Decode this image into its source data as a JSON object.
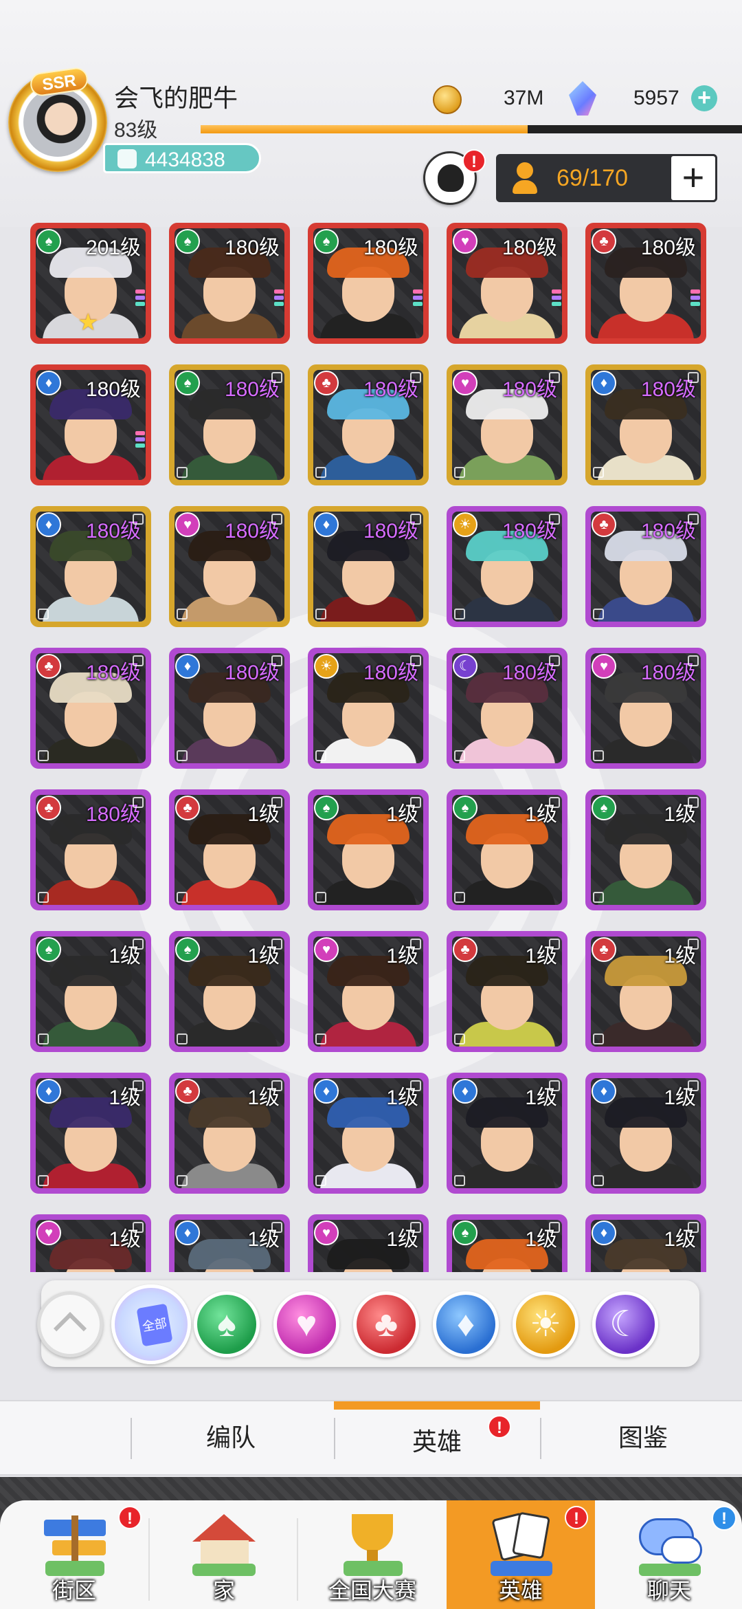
{
  "player": {
    "name": "会飞的肥牛",
    "level": "83级",
    "power": "4434838",
    "rank_badge": "SSR",
    "exp_progress": 0.6
  },
  "currency": {
    "coins": "37M",
    "gems": "5957",
    "coin_icon": "gold-coin-icon",
    "gem_icon": "crystal-gem-icon"
  },
  "hero_capacity": "69/170",
  "notifications": {
    "badge": "!"
  },
  "rarity_colors": {
    "red": "#d63b33",
    "gold": "#d6a62c",
    "purple": "#b04ad0"
  },
  "faction_colors": {
    "spade": "#23a04e",
    "heart": "#d23fba",
    "club": "#d33a3e",
    "diamond": "#2f77d8",
    "sun": "#e6a218",
    "moon": "#7741cf"
  },
  "heroes": [
    {
      "level": "201级",
      "rarity": "red",
      "faction": "spade",
      "star": true,
      "hair": "#e9e9ee",
      "cloth": "#d8d8dc"
    },
    {
      "level": "180级",
      "rarity": "red",
      "faction": "spade",
      "hair": "#4a2a1a",
      "cloth": "#6b4a2c"
    },
    {
      "level": "180级",
      "rarity": "red",
      "faction": "spade",
      "hair": "#e2641c",
      "cloth": "#222"
    },
    {
      "level": "180级",
      "rarity": "red",
      "faction": "heart",
      "hair": "#9c2c22",
      "cloth": "#e6d2a0"
    },
    {
      "level": "180级",
      "rarity": "red",
      "faction": "club",
      "hair": "#2a2220",
      "cloth": "#c8302a"
    },
    {
      "level": "180级",
      "rarity": "red",
      "faction": "diamond",
      "hair": "#3a2a6a",
      "cloth": "#b02030"
    },
    {
      "level": "180级",
      "rarity": "gold",
      "faction": "spade",
      "hair": "#2a2a2a",
      "cloth": "#355a3a"
    },
    {
      "level": "180级",
      "rarity": "gold",
      "faction": "club",
      "hair": "#5bb7e2",
      "cloth": "#2d5e9a"
    },
    {
      "level": "180级",
      "rarity": "gold",
      "faction": "heart",
      "hair": "#eeeeee",
      "cloth": "#7aa05a"
    },
    {
      "level": "180级",
      "rarity": "gold",
      "faction": "diamond",
      "hair": "#3a2e20",
      "cloth": "#e8e0c8"
    },
    {
      "level": "180级",
      "rarity": "gold",
      "faction": "diamond",
      "hair": "#3a4a2a",
      "cloth": "#c8d4d8"
    },
    {
      "level": "180级",
      "rarity": "gold",
      "faction": "heart",
      "hair": "#2a1e14",
      "cloth": "#c49a6a"
    },
    {
      "level": "180级",
      "rarity": "gold",
      "faction": "diamond",
      "hair": "#1c1c24",
      "cloth": "#7a1c1c"
    },
    {
      "level": "180级",
      "rarity": "purple",
      "faction": "sun",
      "hair": "#5acfc8",
      "cloth": "#2c3444"
    },
    {
      "level": "180级",
      "rarity": "purple",
      "faction": "club",
      "hair": "#d8dce8",
      "cloth": "#3a4a8a"
    },
    {
      "level": "180级",
      "rarity": "purple",
      "faction": "club",
      "hair": "#e8dcc4",
      "cloth": "#2a2a22"
    },
    {
      "level": "180级",
      "rarity": "purple",
      "faction": "diamond",
      "hair": "#3a2820",
      "cloth": "#5a3a5a"
    },
    {
      "level": "180级",
      "rarity": "purple",
      "faction": "sun",
      "hair": "#2a2418",
      "cloth": "#f2f2f2"
    },
    {
      "level": "180级",
      "rarity": "purple",
      "faction": "moon",
      "hair": "#5a2e3e",
      "cloth": "#f0c4d8"
    },
    {
      "level": "180级",
      "rarity": "purple",
      "faction": "heart",
      "hair": "#3a3a3a",
      "cloth": "#2a2a2a"
    },
    {
      "level": "180级",
      "rarity": "purple",
      "faction": "club",
      "hair": "#2a2a2a",
      "cloth": "#a82a22"
    },
    {
      "level": "1级",
      "rarity": "purple",
      "faction": "club",
      "hair": "#2a1e14",
      "cloth": "#c8302a"
    },
    {
      "level": "1级",
      "rarity": "purple",
      "faction": "spade",
      "hair": "#e2641c",
      "cloth": "#222"
    },
    {
      "level": "1级",
      "rarity": "purple",
      "faction": "spade",
      "hair": "#e2641c",
      "cloth": "#222"
    },
    {
      "level": "1级",
      "rarity": "purple",
      "faction": "spade",
      "hair": "#2a2a2a",
      "cloth": "#355a3a"
    },
    {
      "level": "1级",
      "rarity": "purple",
      "faction": "spade",
      "hair": "#2a2a2a",
      "cloth": "#355a3a"
    },
    {
      "level": "1级",
      "rarity": "purple",
      "faction": "spade",
      "hair": "#3a2a1a",
      "cloth": "#2a2a2a"
    },
    {
      "level": "1级",
      "rarity": "purple",
      "faction": "heart",
      "hair": "#3a2418",
      "cloth": "#b02440"
    },
    {
      "level": "1级",
      "rarity": "purple",
      "faction": "club",
      "hair": "#2a2418",
      "cloth": "#c8c84a"
    },
    {
      "level": "1级",
      "rarity": "purple",
      "faction": "club",
      "hair": "#c89a3a",
      "cloth": "#3a2a2a"
    },
    {
      "level": "1级",
      "rarity": "purple",
      "faction": "diamond",
      "hair": "#3a2a6a",
      "cloth": "#b02030"
    },
    {
      "level": "1级",
      "rarity": "purple",
      "faction": "club",
      "hair": "#4a3a2a",
      "cloth": "#8a8a8a"
    },
    {
      "level": "1级",
      "rarity": "purple",
      "faction": "diamond",
      "hair": "#2f5fb0",
      "cloth": "#e8e8f0"
    },
    {
      "level": "1级",
      "rarity": "purple",
      "faction": "diamond",
      "hair": "#1c1c24",
      "cloth": "#2a2a2a"
    },
    {
      "level": "1级",
      "rarity": "purple",
      "faction": "diamond",
      "hair": "#1c1c24",
      "cloth": "#2a2a2a"
    },
    {
      "level": "1级",
      "rarity": "purple",
      "faction": "heart",
      "hair": "#6a2a2a",
      "cloth": "#2a2a2a"
    },
    {
      "level": "1级",
      "rarity": "purple",
      "faction": "diamond",
      "hair": "#5a6a7a",
      "cloth": "#2a2a2a"
    },
    {
      "level": "1级",
      "rarity": "purple",
      "faction": "heart",
      "hair": "#1c1c1c",
      "cloth": "#2a2a2a"
    },
    {
      "level": "1级",
      "rarity": "purple",
      "faction": "spade",
      "hair": "#e2641c",
      "cloth": "#222"
    },
    {
      "level": "1级",
      "rarity": "purple",
      "faction": "diamond",
      "hair": "#4a3a2a",
      "cloth": "#2a2a2a"
    }
  ],
  "filters": {
    "collapse_icon": "chevron-up-icon",
    "all_label": "全部",
    "items": [
      "spade",
      "heart",
      "club",
      "diamond",
      "sun",
      "moon"
    ]
  },
  "sub_tabs": [
    {
      "label": "编队"
    },
    {
      "label": "英雄",
      "active": true,
      "badge": "!"
    },
    {
      "label": "图鉴"
    }
  ],
  "bottom_nav": [
    {
      "label": "街区",
      "icon": "signpost-icon",
      "badge": "!"
    },
    {
      "label": "家",
      "icon": "house-icon"
    },
    {
      "label": "全国大赛",
      "icon": "trophy-icon"
    },
    {
      "label": "英雄",
      "icon": "hero-cards-icon",
      "badge": "!",
      "active": true
    },
    {
      "label": "聊天",
      "icon": "chat-bubble-icon",
      "badge": "!"
    }
  ]
}
